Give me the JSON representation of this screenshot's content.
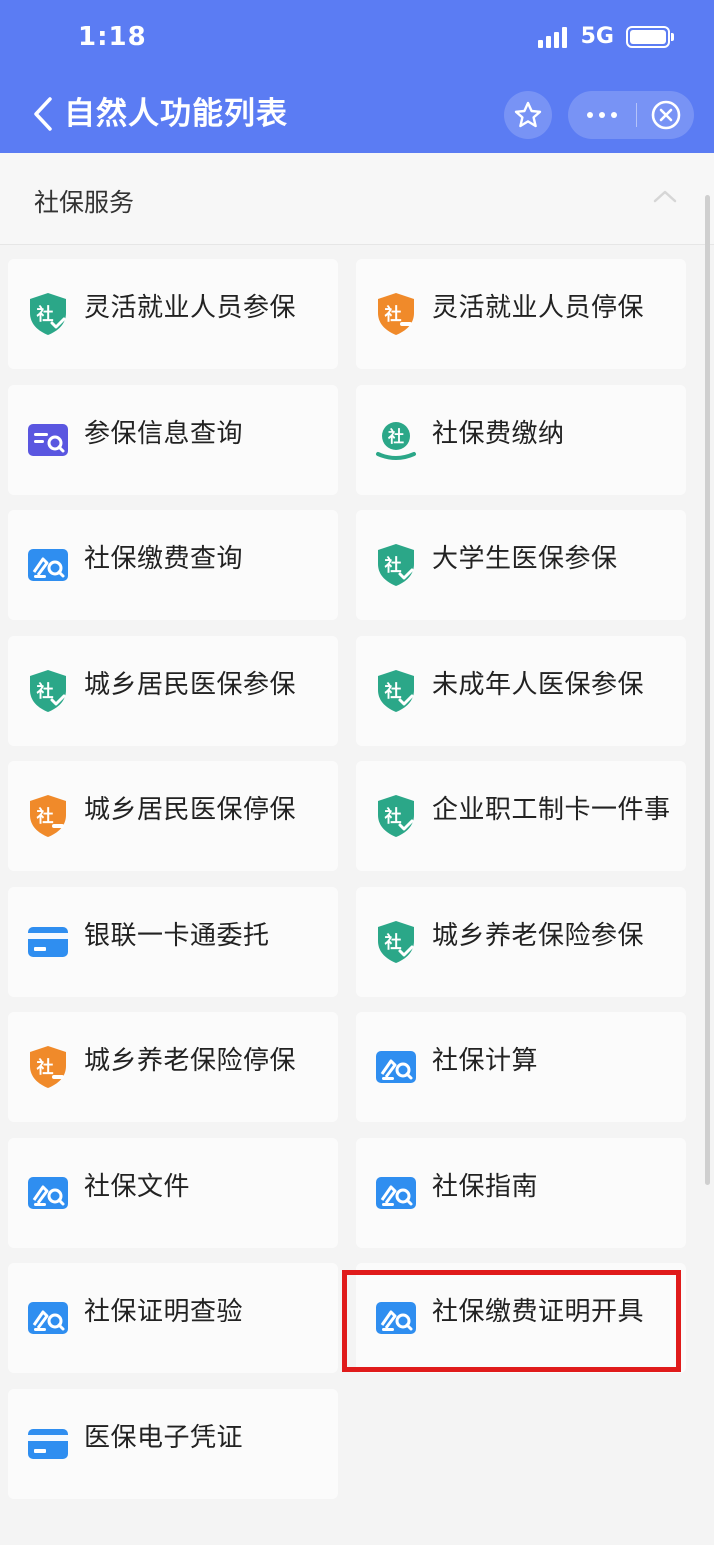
{
  "status_bar": {
    "time": "1:18",
    "network": "5G"
  },
  "nav": {
    "title": "自然人功能列表"
  },
  "section": {
    "title": "社保服务"
  },
  "colors": {
    "header": "#5b7cf3",
    "shield_green": "#2ba788",
    "shield_orange": "#f08a2a",
    "doc_blue": "#2f8ef0",
    "query_purple": "#5a56e0",
    "highlight": "#e01b1b"
  },
  "items": [
    {
      "label": "灵活就业人员参保",
      "icon": "shield-check-icon"
    },
    {
      "label": "灵活就业人员停保",
      "icon": "shield-stop-icon"
    },
    {
      "label": "参保信息查询",
      "icon": "search-list-icon"
    },
    {
      "label": "社保费缴纳",
      "icon": "payment-icon"
    },
    {
      "label": "社保缴费查询",
      "icon": "doc-search-icon"
    },
    {
      "label": "大学生医保参保",
      "icon": "shield-check-icon"
    },
    {
      "label": "城乡居民医保参保",
      "icon": "shield-check-icon"
    },
    {
      "label": "未成年人医保参保",
      "icon": "shield-check-icon"
    },
    {
      "label": "城乡居民医保停保",
      "icon": "shield-stop-icon"
    },
    {
      "label": "企业职工制卡一件事",
      "icon": "shield-check-icon"
    },
    {
      "label": "银联一卡通委托",
      "icon": "card-icon"
    },
    {
      "label": "城乡养老保险参保",
      "icon": "shield-check-icon"
    },
    {
      "label": "城乡养老保险停保",
      "icon": "shield-stop-icon"
    },
    {
      "label": "社保计算",
      "icon": "doc-search-icon"
    },
    {
      "label": "社保文件",
      "icon": "doc-search-icon"
    },
    {
      "label": "社保指南",
      "icon": "doc-search-icon"
    },
    {
      "label": "社保证明查验",
      "icon": "doc-search-icon"
    },
    {
      "label": "社保缴费证明开具",
      "icon": "doc-search-icon"
    },
    {
      "label": "医保电子凭证",
      "icon": "card-icon"
    }
  ]
}
